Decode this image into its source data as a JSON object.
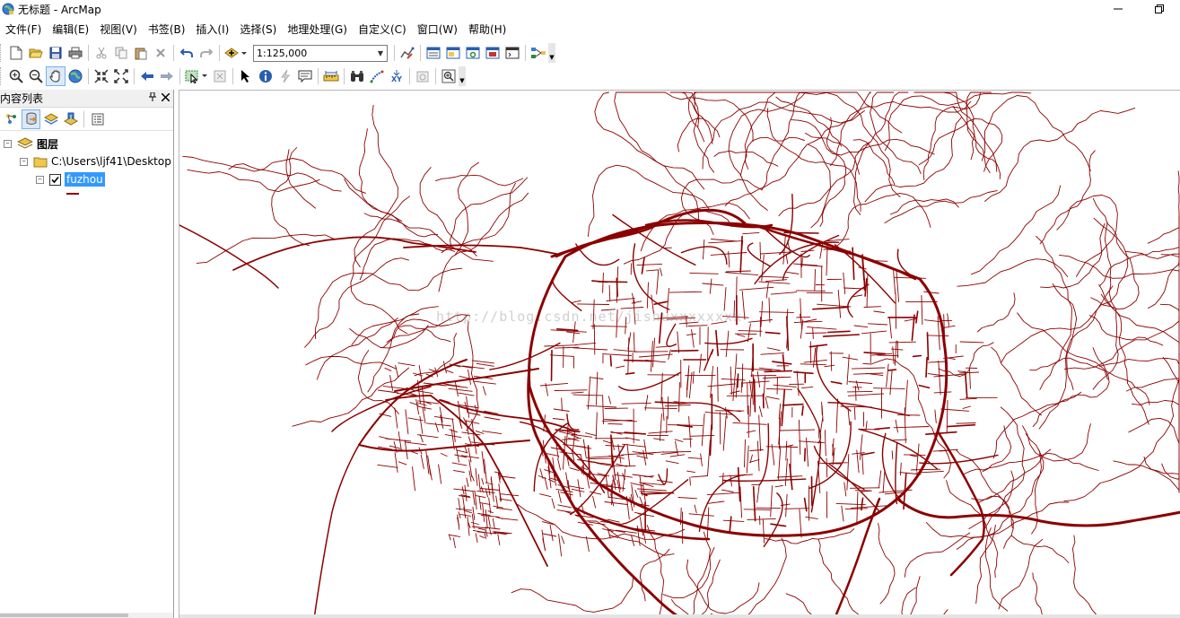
{
  "window": {
    "title": "无标题 - ArcMap",
    "icon": "arcmap-globe-icon",
    "controls": [
      "minimize-icon",
      "restore-icon"
    ]
  },
  "menu": {
    "items": [
      "文件(F)",
      "编辑(E)",
      "视图(V)",
      "书签(B)",
      "插入(I)",
      "选择(S)",
      "地理处理(G)",
      "自定义(C)",
      "窗口(W)",
      "帮助(H)"
    ]
  },
  "standard_toolbar": {
    "scale_value": "1:125,000",
    "icons": [
      "new-document-icon",
      "open-folder-icon",
      "save-icon",
      "print-icon",
      "cut-icon",
      "copy-icon",
      "paste-icon",
      "delete-icon",
      "undo-icon",
      "redo-icon",
      "add-data-icon",
      "editor-icon",
      "table-of-contents-icon",
      "catalog-icon",
      "search-window-icon",
      "arctoolbox-icon",
      "python-icon",
      "model-builder-icon"
    ]
  },
  "tools_toolbar": {
    "icons": [
      "zoom-in-icon",
      "zoom-out-icon",
      "pan-icon",
      "full-extent-icon",
      "fixed-zoom-in-icon",
      "fixed-zoom-out-icon",
      "back-extent-icon",
      "forward-extent-icon",
      "select-features-icon",
      "clear-selection-icon",
      "select-elements-icon",
      "identify-icon",
      "hyperlink-icon",
      "html-popup-icon",
      "measure-icon",
      "find-icon",
      "find-route-icon",
      "go-to-xy-icon",
      "time-slider-icon",
      "create-viewer-icon"
    ]
  },
  "toc": {
    "title": "内容列表",
    "pin_icon": "pin-icon",
    "close_icon": "close-icon",
    "tool_icons": [
      "list-by-drawing-order-icon",
      "list-by-source-icon",
      "list-by-visibility-icon",
      "list-by-selection-icon",
      "options-icon"
    ],
    "tree": {
      "root_label": "图层",
      "folder_label": "C:\\Users\\ljf41\\Desktop",
      "layer_label": "fuzhou",
      "layer_checked": true,
      "symbol_color": "#8b0000"
    }
  },
  "map": {
    "line_color": "#8b0000",
    "watermark": "http://blog.csdn.net/jishuxxxxxxxx"
  }
}
